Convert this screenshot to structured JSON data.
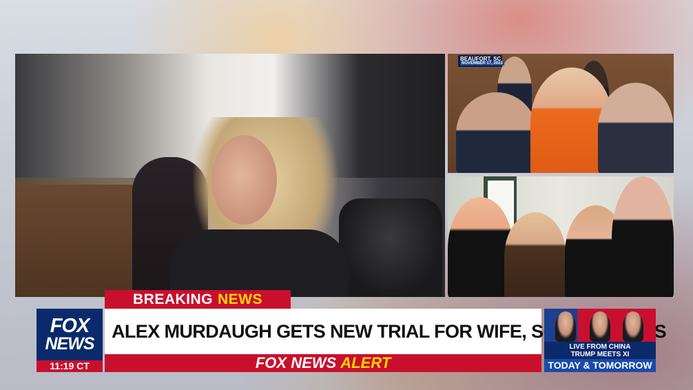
{
  "screen": {
    "type": "broadcast-frame",
    "accent_red": "#c8102e",
    "accent_blue": "#0b2a6b",
    "accent_yellow": "#ffd700"
  },
  "location_tag": {
    "city": "BEAUFORT, SC",
    "date": "NOVEMBER 17, 2023"
  },
  "banner": {
    "breaking_word1": "BREAKING",
    "breaking_word2": "NEWS",
    "headline": "ALEX MURDAUGH GETS NEW TRIAL FOR WIFE, SON MURDERS",
    "alert_word1": "FOX NEWS",
    "alert_word2": "ALERT"
  },
  "logo": {
    "line1": "FOX",
    "line2": "NEWS",
    "time": "11:19 CT"
  },
  "promo": {
    "line1": "LIVE FROM CHINA",
    "line2": "TRUMP MEETS XI",
    "line3": "TODAY & TOMORROW"
  }
}
